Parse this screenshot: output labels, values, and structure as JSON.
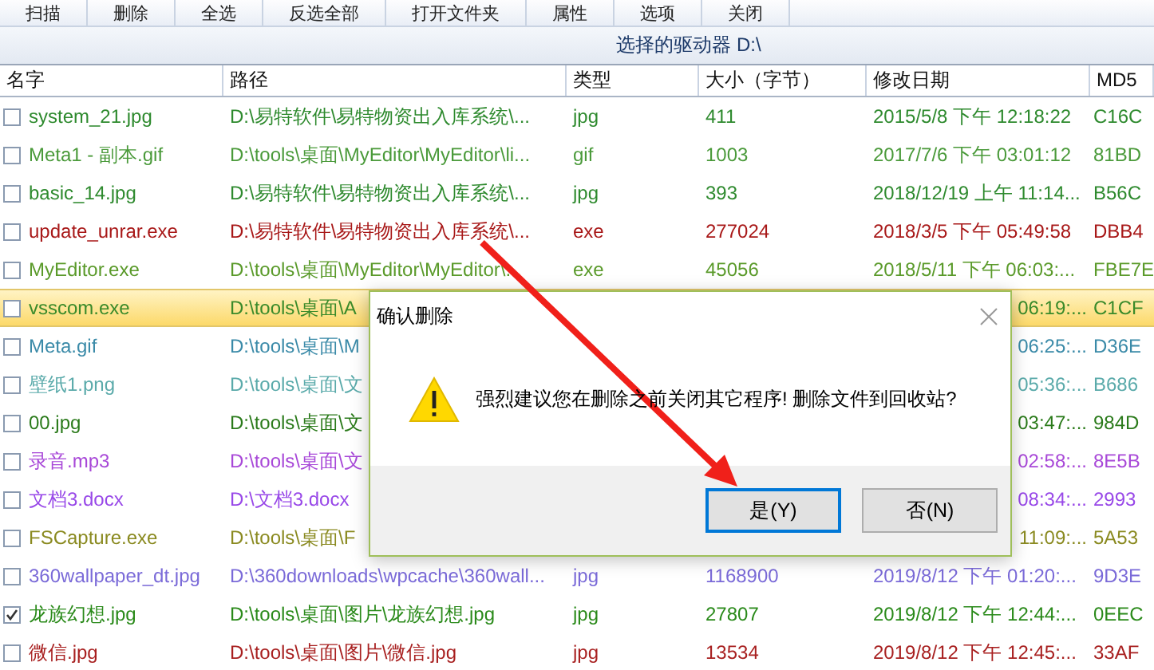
{
  "toolbar": [
    "扫描",
    "删除",
    "全选",
    "反选全部",
    "打开文件夹",
    "属性",
    "选项",
    "关闭"
  ],
  "drive_label": "选择的驱动器 D:\\",
  "columns": [
    "名字",
    "路径",
    "类型",
    "大小（字节）",
    "修改日期",
    "MD5"
  ],
  "rows": [
    {
      "checked": false,
      "selected": false,
      "color": "#2e8a2e",
      "name": "system_21.jpg",
      "path": "D:\\易特软件\\易特物资出入库系统\\...",
      "type": "jpg",
      "size": "411",
      "modified": "2015/5/8 下午 12:18:22",
      "md5": "C16C"
    },
    {
      "checked": false,
      "selected": false,
      "color": "#4a9a3a",
      "name": "Meta1 - 副本.gif",
      "path": "D:\\tools\\桌面\\MyEditor\\MyEditor\\li...",
      "type": "gif",
      "size": "1003",
      "modified": "2017/7/6 下午 03:01:12",
      "md5": "81BD"
    },
    {
      "checked": false,
      "selected": false,
      "color": "#2e8a2e",
      "name": "basic_14.jpg",
      "path": "D:\\易特软件\\易特物资出入库系统\\...",
      "type": "jpg",
      "size": "393",
      "modified": "2018/12/19 上午 11:14...",
      "md5": "B56C"
    },
    {
      "checked": false,
      "selected": false,
      "color": "#a81818",
      "name": "update_unrar.exe",
      "path": "D:\\易特软件\\易特物资出入库系统\\...",
      "type": "exe",
      "size": "277024",
      "modified": "2018/3/5 下午 05:49:58",
      "md5": "DBB4"
    },
    {
      "checked": false,
      "selected": false,
      "color": "#5a9a2a",
      "name": "MyEditor.exe",
      "path": "D:\\tools\\桌面\\MyEditor\\MyEditor\\...",
      "type": "exe",
      "size": "45056",
      "modified": "2018/5/11 下午 06:03:...",
      "md5": "FBE7E"
    },
    {
      "checked": false,
      "selected": true,
      "color": "#3a8a2a",
      "name": "vsscom.exe",
      "path": "D:\\tools\\桌面\\A",
      "modified": "06:19:...",
      "md5": "C1CF"
    },
    {
      "checked": false,
      "selected": false,
      "color": "#3a8aa8",
      "name": "Meta.gif",
      "path": "D:\\tools\\桌面\\M",
      "modified": "06:25:...",
      "md5": "D36E"
    },
    {
      "checked": false,
      "selected": false,
      "color": "#5aaaaa",
      "name": "壁纸1.png",
      "path": "D:\\tools\\桌面\\文",
      "modified": "05:36:...",
      "md5": "B686"
    },
    {
      "checked": false,
      "selected": false,
      "color": "#2a7a1a",
      "name": "00.jpg",
      "path": "D:\\tools\\桌面\\文",
      "modified": "03:47:...",
      "md5": "984D"
    },
    {
      "checked": false,
      "selected": false,
      "color": "#a848d8",
      "name": "录音.mp3",
      "path": "D:\\tools\\桌面\\文",
      "modified": "02:58:...",
      "md5": "8E5B"
    },
    {
      "checked": false,
      "selected": false,
      "color": "#9848e8",
      "name": "文档3.docx",
      "path": "D:\\文档3.docx",
      "modified": "08:34:...",
      "md5": "2993"
    },
    {
      "checked": false,
      "selected": false,
      "color": "#8a8a20",
      "name": "FSCapture.exe",
      "path": "D:\\tools\\桌面\\F",
      "modified": "11:09:...",
      "md5": "5A53"
    },
    {
      "checked": false,
      "selected": false,
      "color": "#7a6ad8",
      "name": "360wallpaper_dt.jpg",
      "path": "D:\\360downloads\\wpcache\\360wall...",
      "type": "jpg",
      "size": "1168900",
      "modified": "2019/8/12 下午 01:20:...",
      "md5": "9D3E"
    },
    {
      "checked": true,
      "selected": false,
      "color": "#2a8a1a",
      "name": "龙族幻想.jpg",
      "path": "D:\\tools\\桌面\\图片\\龙族幻想.jpg",
      "type": "jpg",
      "size": "27807",
      "modified": "2019/8/12 下午 12:44:...",
      "md5": "0EEC"
    },
    {
      "checked": false,
      "selected": false,
      "color": "#a82020",
      "name": "微信.jpg",
      "path": "D:\\tools\\桌面\\图片\\微信.jpg",
      "type": "jpg",
      "size": "13534",
      "modified": "2019/8/12 下午 12:45:...",
      "md5": "33AF"
    }
  ],
  "dialog": {
    "title": "确认删除",
    "message": "强烈建议您在删除之前关闭其它程序! 删除文件到回收站?",
    "buttons": [
      {
        "label": "是(Y)",
        "focused": true
      },
      {
        "label": "否(N)",
        "focused": false
      }
    ]
  }
}
